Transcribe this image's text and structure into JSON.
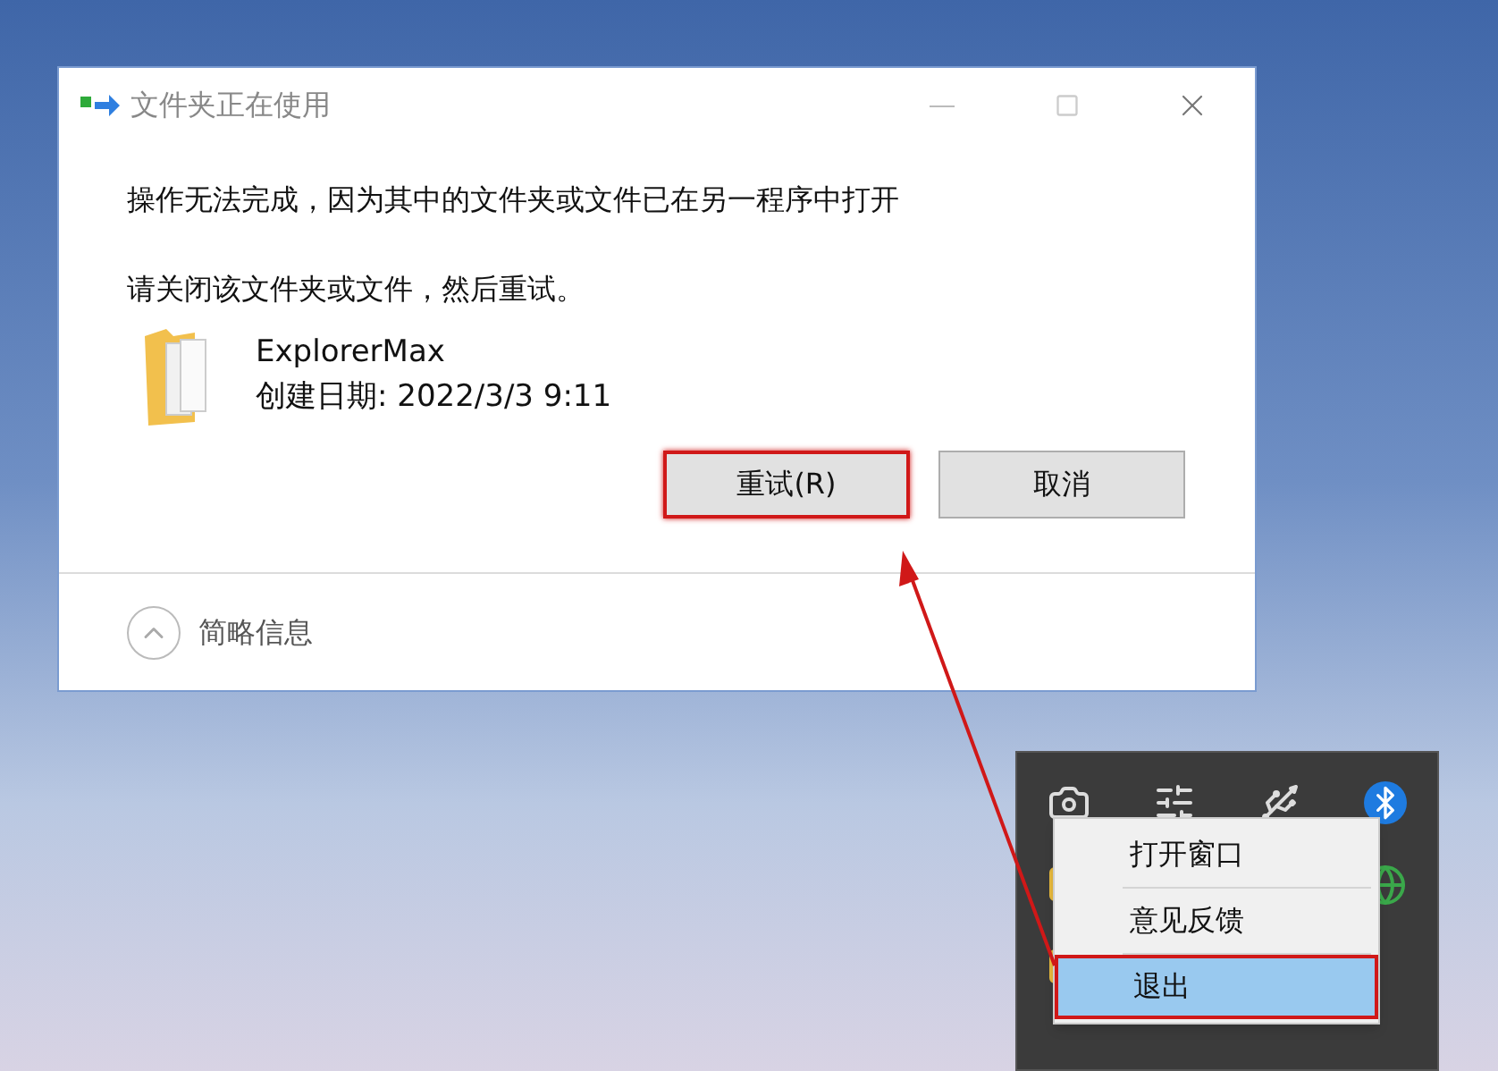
{
  "dialog": {
    "title": "文件夹正在使用",
    "message": "操作无法完成，因为其中的文件夹或文件已在另一程序中打开",
    "instruction": "请关闭该文件夹或文件，然后重试。",
    "file": {
      "name": "ExplorerMax",
      "created": "创建日期: 2022/3/3 9:11"
    },
    "buttons": [
      {
        "label": "重试(R)",
        "annotated": true
      },
      {
        "label": "取消",
        "annotated": false
      }
    ],
    "details_toggle": "简略信息"
  },
  "tray_menu": {
    "items": [
      {
        "label": "打开窗口",
        "selected": false,
        "annotated": false
      },
      {
        "label": "意见反馈",
        "selected": false,
        "annotated": false
      },
      {
        "label": "退出",
        "selected": true,
        "annotated": true
      }
    ]
  }
}
